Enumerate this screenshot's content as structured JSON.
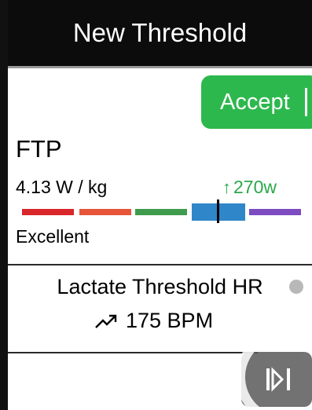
{
  "header": {
    "title": "New Threshold"
  },
  "accept": {
    "label": "Accept"
  },
  "ftp": {
    "title": "FTP",
    "power_to_weight": "4.13 W / kg",
    "watts": "270w",
    "rating": "Excellent",
    "zone_colors": [
      "#d8262a",
      "#e6553a",
      "#3f9b4d",
      "#2f86c9",
      "#7d4cc0"
    ],
    "current_zone_index": 3,
    "marker_position_in_zone": 0.45
  },
  "lthr": {
    "title": "Lactate Threshold HR",
    "value": "175 BPM"
  },
  "colors": {
    "header_bg": "#0c0c0c",
    "accept_green": "#2db84d",
    "increase_green": "#2aa84a",
    "scroll_button": "#5a5a5a"
  },
  "icons": {
    "watts_change": "up-arrow-icon",
    "lthr_trend": "trending-up-icon",
    "status_dot": "status-dot-icon",
    "scroll": "page-scroll-icon"
  }
}
